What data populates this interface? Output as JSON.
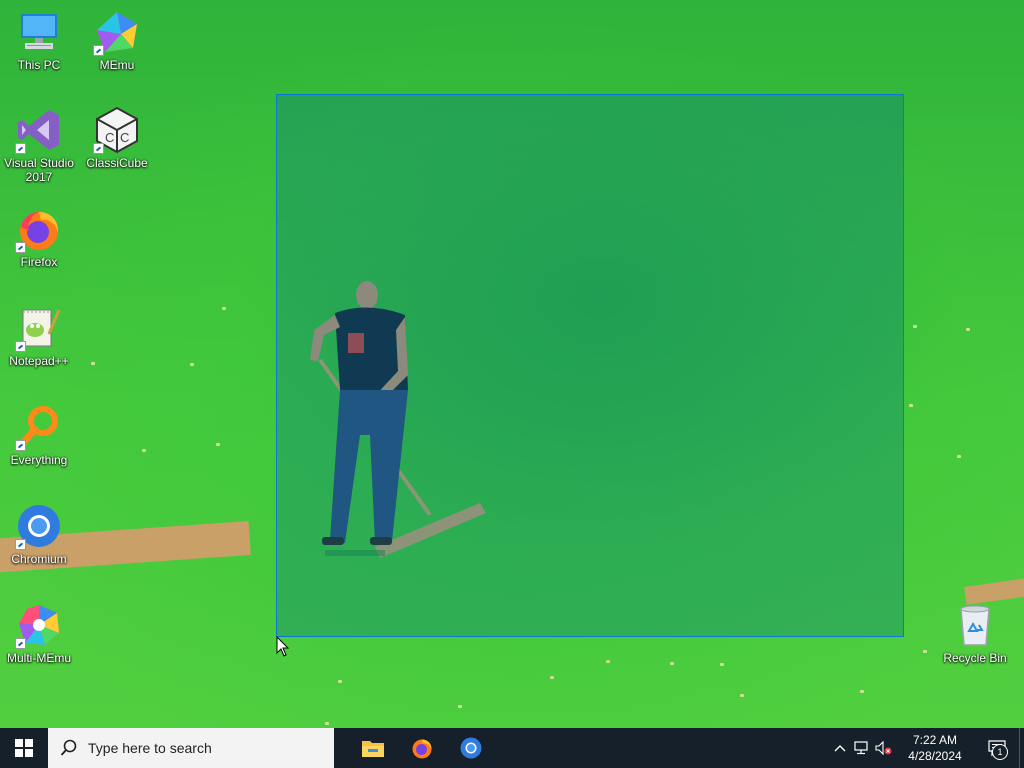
{
  "desktop": {
    "icons": [
      {
        "label": "This PC",
        "icon": "computer-icon"
      },
      {
        "label": "MEmu",
        "icon": "memu-icon"
      },
      {
        "label": "Visual Studio 2017",
        "icon": "visual-studio-icon"
      },
      {
        "label": "ClassiCube",
        "icon": "classicube-icon"
      },
      {
        "label": "Firefox",
        "icon": "firefox-icon"
      },
      {
        "label": "Notepad++",
        "icon": "notepadpp-icon"
      },
      {
        "label": "Everything",
        "icon": "everything-icon"
      },
      {
        "label": "Chromium",
        "icon": "chromium-icon"
      },
      {
        "label": "Multi-MEmu",
        "icon": "multi-memu-icon"
      },
      {
        "label": "Recycle Bin",
        "icon": "recycle-bin-icon"
      }
    ]
  },
  "taskbar": {
    "search_placeholder": "Type here to search",
    "pinned": [
      {
        "name": "File Explorer",
        "icon": "file-explorer-icon"
      },
      {
        "name": "Firefox",
        "icon": "firefox-icon"
      },
      {
        "name": "Chromium",
        "icon": "chromium-icon"
      }
    ],
    "clock": {
      "time": "7:22 AM",
      "date": "4/28/2024"
    },
    "notification_count": "1"
  },
  "colors": {
    "taskbar_bg": "#16202a",
    "selection_border": "#0a78d7",
    "desktop_green": "#3cc83a"
  }
}
